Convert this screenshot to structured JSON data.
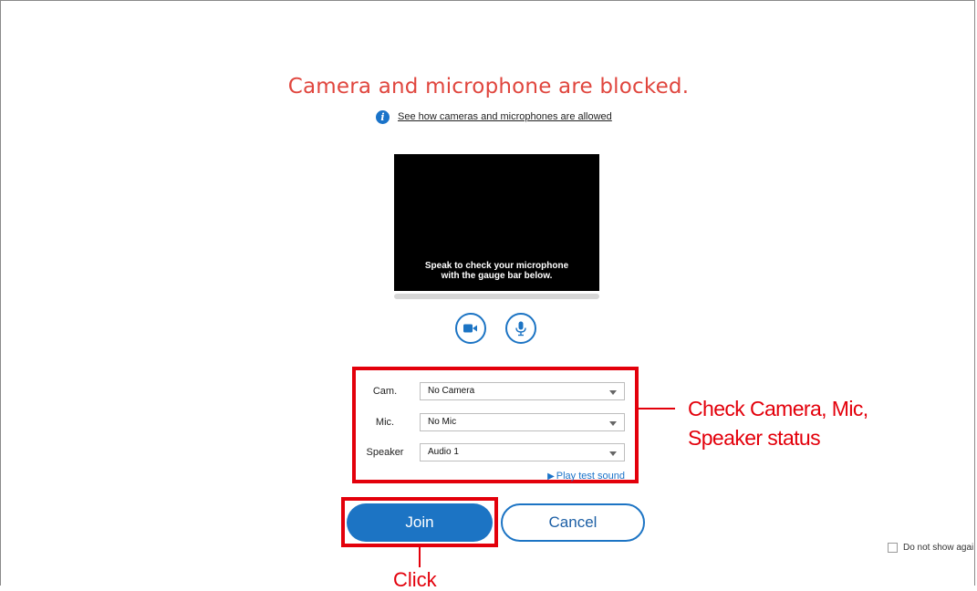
{
  "title": "Camera and microphone are blocked.",
  "help": {
    "icon": "info-icon",
    "link_text": "See how cameras and microphones are allowed"
  },
  "preview": {
    "line1": "Speak to check your microphone",
    "line2": "with the gauge bar below."
  },
  "toggles": {
    "camera_icon": "video-camera-icon",
    "mic_icon": "microphone-icon"
  },
  "devices": {
    "rows": [
      {
        "label": "Cam.",
        "value": "No Camera"
      },
      {
        "label": "Mic.",
        "value": "No Mic"
      },
      {
        "label": "Speaker",
        "value": "Audio 1"
      }
    ],
    "play_test_sound": "Play test sound"
  },
  "annotations": {
    "device_callout_line1": "Check Camera, Mic,",
    "device_callout_line2": "Speaker status",
    "click_callout": "Click"
  },
  "buttons": {
    "join": "Join",
    "cancel": "Cancel"
  },
  "do_not_show": {
    "label": "Do not show agai",
    "checked": false
  },
  "colors": {
    "alert": "#e0463e",
    "accent": "#1c74c4",
    "highlight": "#e3000b"
  }
}
